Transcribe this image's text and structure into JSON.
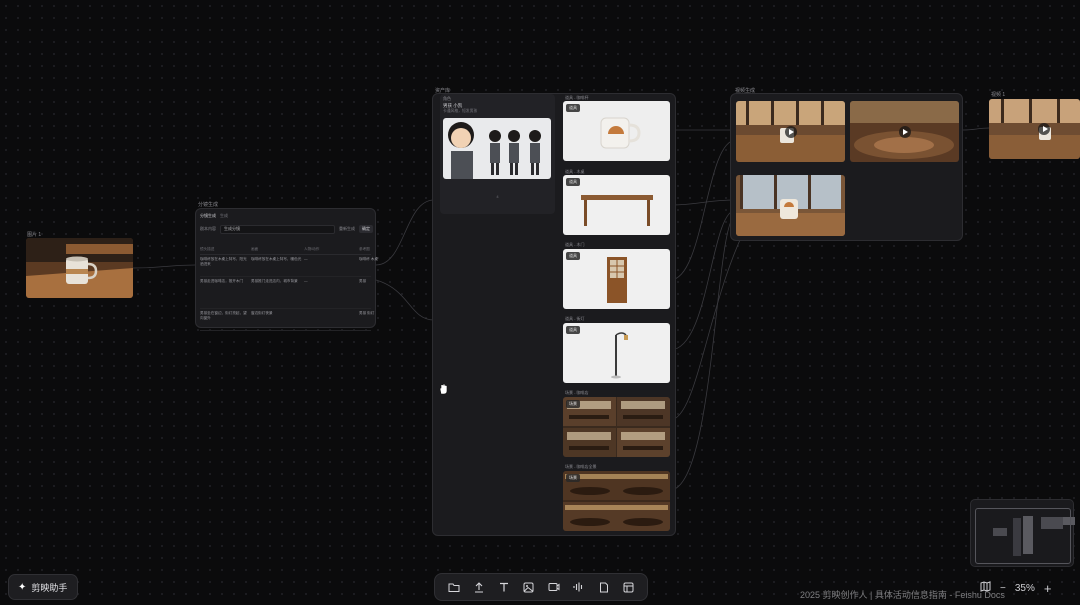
{
  "source_node": {
    "label": "图片 1"
  },
  "script_node": {
    "label": "分镜生成",
    "tab_active": "分镜生成",
    "tab_other": "生成",
    "field_label": "剧本内容",
    "field_value": "生成分镜",
    "btn_a": "重新生成",
    "btn_b": "确定",
    "columns": [
      "镜头描述",
      "画面",
      "人物/动作",
      "参考图"
    ],
    "rows": [
      [
        "咖啡杯放在木桌上特写，阳光洒进来",
        "咖啡杯放在木桌上特写，暖色光",
        "—",
        "咖啡杯 木桌"
      ],
      [
        "男孩走进咖啡店，推开木门",
        "男孩推门走进店内，城市背景",
        "—",
        "男孩"
      ],
      [
        "男孩坐在窗边，街灯亮起，望向窗外",
        "窗边街灯夜景",
        "",
        "男孩 街灯"
      ]
    ]
  },
  "assets_panel": {
    "label": "资产库",
    "character": {
      "label": "角色",
      "name": "男孩 小凯",
      "desc": "卡通风格，短发男孩",
      "count": "4"
    },
    "items": [
      {
        "label": "道具 - 咖啡杯",
        "tag": "道具"
      },
      {
        "label": "道具 - 木桌",
        "tag": "道具"
      },
      {
        "label": "道具 - 木门",
        "tag": "道具"
      },
      {
        "label": "道具 - 街灯",
        "tag": "道具"
      },
      {
        "label": "场景 - 咖啡店",
        "tag": "场景"
      },
      {
        "label": "场景 - 咖啡店全景",
        "tag": "场景"
      }
    ]
  },
  "video_panel": {
    "label": "视频生成"
  },
  "video_right": {
    "label": "视频 1"
  },
  "assistant": {
    "label": "剪映助手"
  },
  "zoom": {
    "value": "35%",
    "minus": "−",
    "plus": "+"
  },
  "banner": {
    "text": "2025 剪映创作人 | 具体活动信息指南 - Feishu Docs"
  },
  "colors": {
    "background": "#0b0b0c",
    "panel": "#1b1b1e",
    "accent": "#c47a3c"
  }
}
